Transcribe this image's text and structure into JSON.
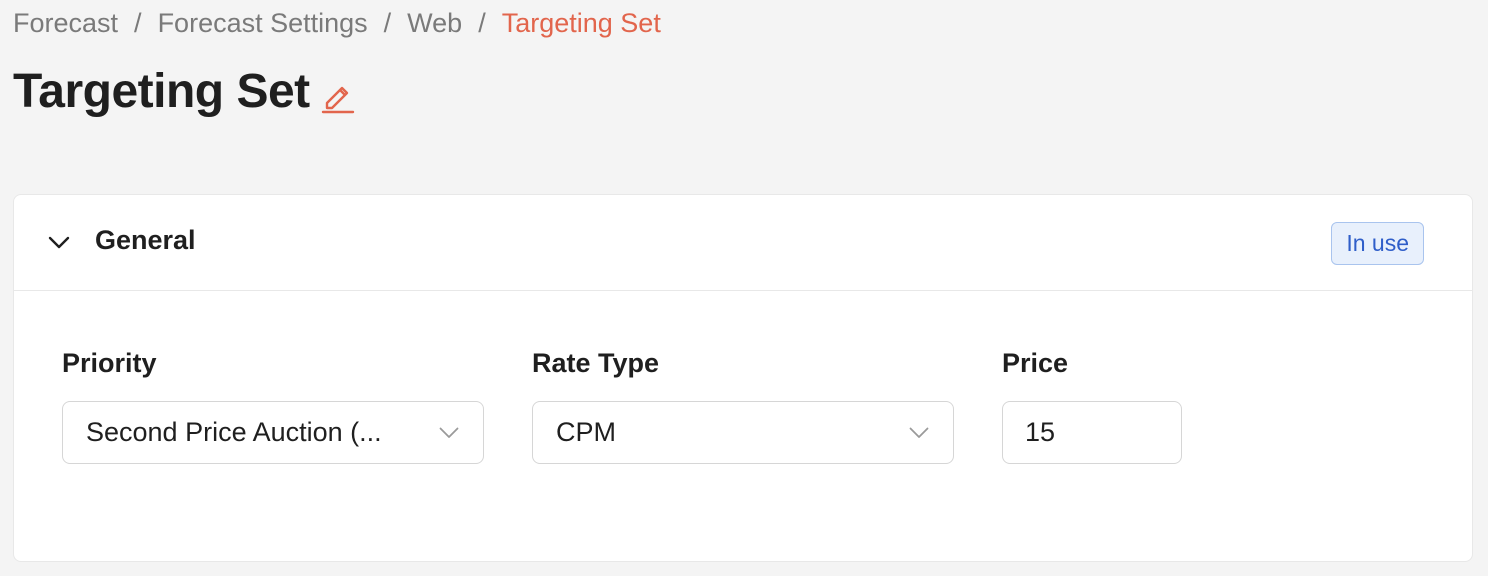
{
  "breadcrumb": {
    "items": [
      "Forecast",
      "Forecast Settings",
      "Web"
    ],
    "current": "Targeting Set",
    "separator": "/"
  },
  "page": {
    "title": "Targeting Set",
    "edit_icon": "pencil-icon"
  },
  "section": {
    "title": "General",
    "status": "In use",
    "collapse_icon": "chevron-down-icon"
  },
  "fields": {
    "priority": {
      "label": "Priority",
      "value": "Second Price Auction (..."
    },
    "rate_type": {
      "label": "Rate Type",
      "value": "CPM"
    },
    "price": {
      "label": "Price",
      "value": "15"
    }
  },
  "colors": {
    "accent": "#e2654c",
    "badge_bg": "#e8f0fc",
    "badge_text": "#2f5ec9",
    "page_bg": "#f4f4f4"
  }
}
